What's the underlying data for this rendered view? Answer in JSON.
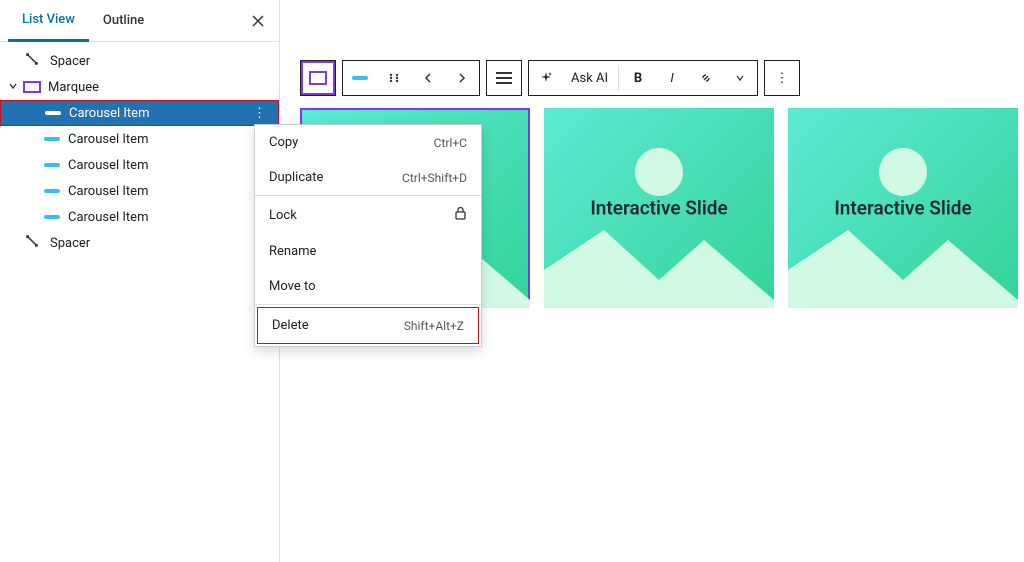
{
  "tabs": {
    "list_view": "List View",
    "outline": "Outline"
  },
  "tree": {
    "spacer_top": "Spacer",
    "marquee": "Marquee",
    "carousel_selected": "Carousel Item",
    "carousel_item": "Carousel Item",
    "spacer_bottom": "Spacer"
  },
  "toolbar": {
    "ask_ai": "Ask AI"
  },
  "slides": {
    "label": "Interactive Slide"
  },
  "context_menu": {
    "copy": {
      "label": "Copy",
      "shortcut": "Ctrl+C"
    },
    "duplicate": {
      "label": "Duplicate",
      "shortcut": "Ctrl+Shift+D"
    },
    "lock": {
      "label": "Lock"
    },
    "rename": {
      "label": "Rename"
    },
    "move_to": {
      "label": "Move to"
    },
    "delete": {
      "label": "Delete",
      "shortcut": "Shift+Alt+Z"
    }
  }
}
